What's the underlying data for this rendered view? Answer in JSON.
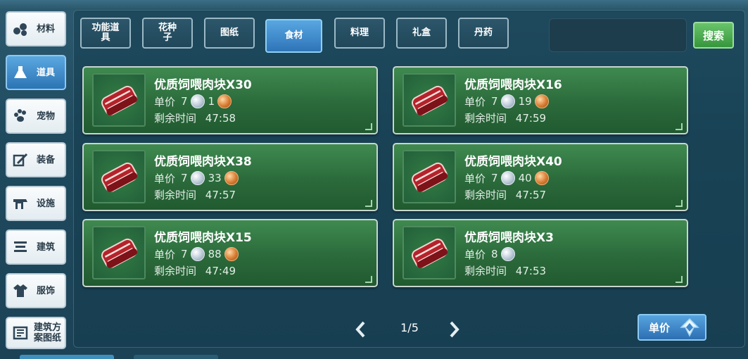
{
  "sidebar": {
    "items": [
      {
        "label": "材料",
        "icon": "materials-icon"
      },
      {
        "label": "道具",
        "icon": "flask-icon",
        "active": true
      },
      {
        "label": "宠物",
        "icon": "paw-icon"
      },
      {
        "label": "装备",
        "icon": "equipment-icon"
      },
      {
        "label": "设施",
        "icon": "facility-icon"
      },
      {
        "label": "建筑",
        "icon": "building-icon"
      },
      {
        "label": "服饰",
        "icon": "clothing-icon"
      },
      {
        "label": "建筑方案图纸",
        "icon": "blueprint-icon"
      }
    ]
  },
  "tabs": [
    {
      "label": "功能道具"
    },
    {
      "label": "花种子"
    },
    {
      "label": "图纸"
    },
    {
      "label": "食材",
      "active": true
    },
    {
      "label": "料理"
    },
    {
      "label": "礼盒"
    },
    {
      "label": "丹药"
    }
  ],
  "search": {
    "value": "",
    "button_label": "搜索"
  },
  "listings": [
    {
      "name": "优质饲喂肉块X30",
      "price_label": "单价",
      "silver": "7",
      "copper": "1",
      "time_label": "剩余时间",
      "time": "47:58"
    },
    {
      "name": "优质饲喂肉块X16",
      "price_label": "单价",
      "silver": "7",
      "copper": "19",
      "time_label": "剩余时间",
      "time": "47:59"
    },
    {
      "name": "优质饲喂肉块X38",
      "price_label": "单价",
      "silver": "7",
      "copper": "33",
      "time_label": "剩余时间",
      "time": "47:57"
    },
    {
      "name": "优质饲喂肉块X40",
      "price_label": "单价",
      "silver": "7",
      "copper": "40",
      "time_label": "剩余时间",
      "time": "47:57"
    },
    {
      "name": "优质饲喂肉块X15",
      "price_label": "单价",
      "silver": "7",
      "copper": "88",
      "time_label": "剩余时间",
      "time": "47:49"
    },
    {
      "name": "优质饲喂肉块X3",
      "price_label": "单价",
      "silver": "8",
      "copper": "",
      "time_label": "剩余时间",
      "time": "47:53"
    }
  ],
  "pager": {
    "text": "1/5"
  },
  "sort": {
    "label": "单价",
    "icon": "sort-arrow-icon"
  },
  "colors": {
    "card_green": "#2b6a3b",
    "active_blue": "#2e74b8",
    "search_green": "#36963c",
    "panel": "#1c4256"
  }
}
